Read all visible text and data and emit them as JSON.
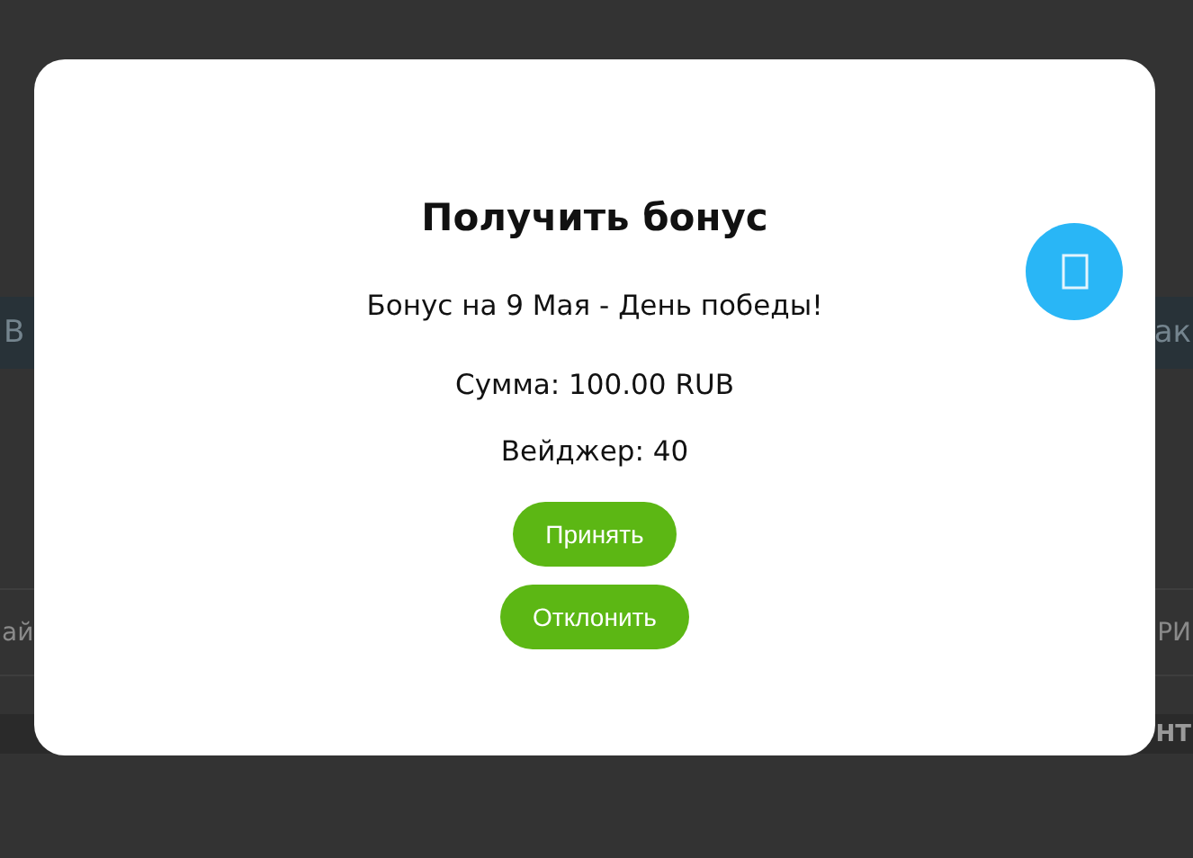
{
  "background": {
    "band": {
      "left_text": "В",
      "right_text": "ак"
    },
    "row": {
      "left_text": "ай",
      "right_text": "РИ"
    },
    "footer": {
      "right_text": "НТ"
    }
  },
  "modal": {
    "title": "Получить бонус",
    "subtitle": "Бонус на 9 Мая - День победы!",
    "details": [
      "Сумма: 100.00 RUB",
      "Вейджер: 40"
    ],
    "buttons": [
      "Принять",
      "Отклонить"
    ]
  }
}
